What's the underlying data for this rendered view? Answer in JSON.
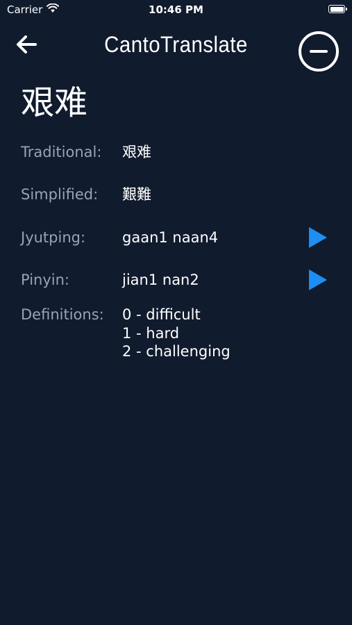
{
  "status_bar": {
    "carrier": "Carrier",
    "time": "10:46 PM"
  },
  "nav": {
    "title": "CantoTranslate",
    "back_icon": "arrow-left-icon",
    "remove_icon": "minus-circle-icon"
  },
  "entry": {
    "headword": "艰难",
    "traditional_label": "Traditional:",
    "traditional_value": "艰难",
    "simplified_label": "Simplified:",
    "simplified_value": "艱難",
    "jyutping_label": "Jyutping:",
    "jyutping_value": "gaan1 naan4",
    "pinyin_label": "Pinyin:",
    "pinyin_value": "jian1 nan2",
    "definitions_label": "Definitions:",
    "definitions": [
      "0 - difficult",
      "1 - hard",
      "2 - challenging"
    ],
    "play_icon": "play-icon"
  },
  "colors": {
    "background": "#111b2e",
    "label": "#9aa3b5",
    "accent": "#1e8ef2"
  }
}
